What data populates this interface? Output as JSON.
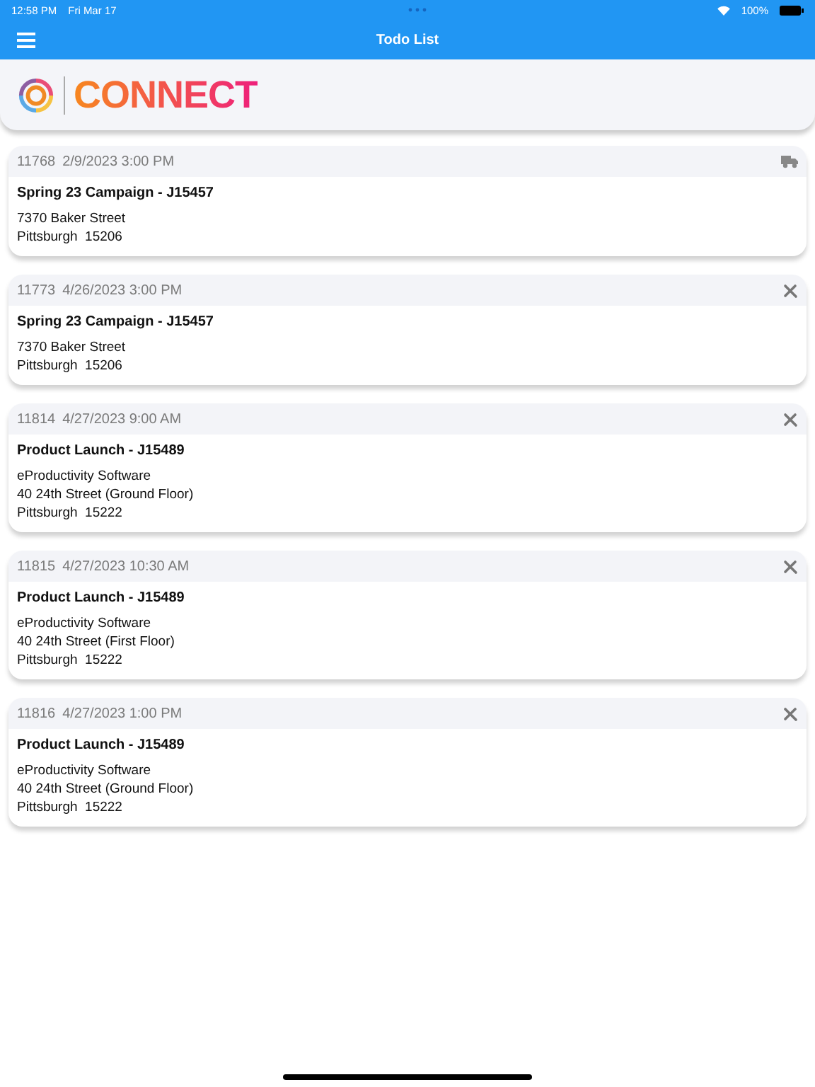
{
  "status_bar": {
    "time": "12:58 PM",
    "date": "Fri Mar 17",
    "battery": "100%"
  },
  "nav_bar": {
    "title": "Todo List"
  },
  "logo": {
    "wordmark": "CONNECT"
  },
  "todos": [
    {
      "kind": "delivery",
      "id": "11768",
      "when": "2/9/2023 3:00 PM",
      "title": "Spring 23 Campaign - J15457",
      "lines": [
        "7370 Baker Street",
        "Pittsburgh  15206"
      ]
    },
    {
      "kind": "service",
      "id": "11773",
      "when": "4/26/2023 3:00 PM",
      "title": "Spring 23 Campaign - J15457",
      "lines": [
        "7370 Baker Street",
        "Pittsburgh  15206"
      ]
    },
    {
      "kind": "service",
      "id": "11814",
      "when": "4/27/2023 9:00 AM",
      "title": "Product Launch - J15489",
      "lines": [
        "eProductivity Software",
        "40 24th Street (Ground Floor)",
        "Pittsburgh  15222"
      ]
    },
    {
      "kind": "service",
      "id": "11815",
      "when": "4/27/2023 10:30 AM",
      "title": "Product Launch - J15489",
      "lines": [
        "eProductivity Software",
        "40 24th Street (First Floor)",
        "Pittsburgh  15222"
      ]
    },
    {
      "kind": "service",
      "id": "11816",
      "when": "4/27/2023 1:00 PM",
      "title": "Product Launch - J15489",
      "lines": [
        "eProductivity Software",
        "40 24th Street (Ground Floor)",
        "Pittsburgh  15222"
      ]
    }
  ]
}
